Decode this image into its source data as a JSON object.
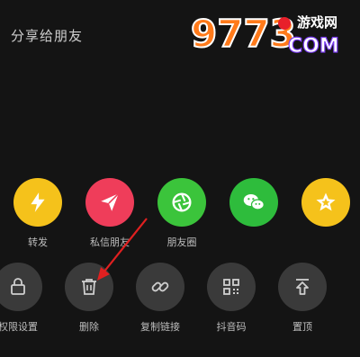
{
  "header": {
    "title": "分享给朋友"
  },
  "watermark": {
    "digits": "9773",
    "brand": "COM",
    "cn_text": "游戏网"
  },
  "share_row": {
    "items": [
      {
        "label": "转发",
        "icon": "lightning-icon",
        "color": "#f5c21b"
      },
      {
        "label": "私信朋友",
        "icon": "paper-plane-icon",
        "color": "#ef3d5a"
      },
      {
        "label": "朋友圈",
        "icon": "camera-shutter-icon",
        "color": "#3bc43b"
      },
      {
        "label": "",
        "icon": "wechat-icon",
        "color": "#2ebc3c"
      },
      {
        "label": "",
        "icon": "star-icon",
        "color": "#f5c21b"
      }
    ]
  },
  "action_row": {
    "items": [
      {
        "label": "权限设置",
        "icon": "lock-icon"
      },
      {
        "label": "删除",
        "icon": "trash-icon"
      },
      {
        "label": "复制链接",
        "icon": "link-icon"
      },
      {
        "label": "抖音码",
        "icon": "qr-code-icon"
      },
      {
        "label": "置顶",
        "icon": "pin-top-icon"
      }
    ]
  },
  "colors": {
    "background": "#141414",
    "annotation_arrow": "#e02020",
    "action_circle": "#3a3a3a"
  }
}
